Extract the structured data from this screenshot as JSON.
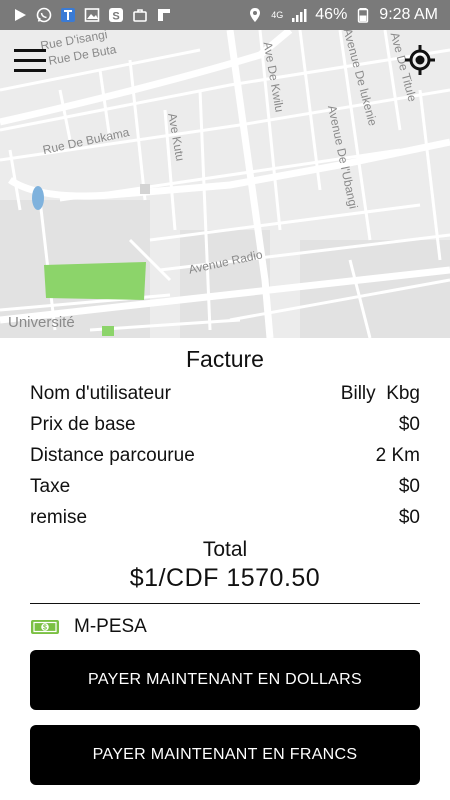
{
  "status_bar": {
    "left_icons": [
      "play-icon",
      "whatsapp-icon",
      "t-app-icon",
      "image-icon",
      "s-app-icon",
      "briefcase-icon",
      "f-app-icon"
    ],
    "network": "4G",
    "battery": "46%",
    "time": "9:28 AM"
  },
  "map": {
    "labels": {
      "rue_disangi": "Rue D'isangi",
      "rue_de_buta": "Rue De Buta",
      "rue_de_bukama": "Rue De Bukama",
      "ave_kutu": "Ave Kutu",
      "ave_de_kwilu": "Ave De Kwilu",
      "avenue_de_lukenie": "Avenue De lukenie",
      "avenue_de_lubangi": "Avenue De l'Ubangi",
      "ave_de_titule": "Ave De Titule",
      "avenue_radio": "Avenue Radio",
      "universite": "Université"
    }
  },
  "invoice": {
    "title": "Facture",
    "rows": [
      {
        "label": "Nom d'utilisateur",
        "value": "Billy  Kbg"
      },
      {
        "label": "Prix de base",
        "value": "$0"
      },
      {
        "label": "Distance parcourue",
        "value": "2 Km"
      },
      {
        "label": "Taxe",
        "value": "$0"
      },
      {
        "label": "remise",
        "value": "$0"
      }
    ],
    "total_label": "Total",
    "total_value": "$1/CDF 1570.50",
    "payment_method": "M-PESA",
    "pay_dollars": "PAYER MAINTENANT EN DOLLARS",
    "pay_francs": "PAYER MAINTENANT EN FRANCS"
  },
  "colors": {
    "status_bar": "#7a7a7a",
    "map_bg": "#ececec",
    "park": "#8cd46a",
    "water": "#7fb2dd",
    "button": "#000000",
    "cash_icon": "#7bc043"
  }
}
